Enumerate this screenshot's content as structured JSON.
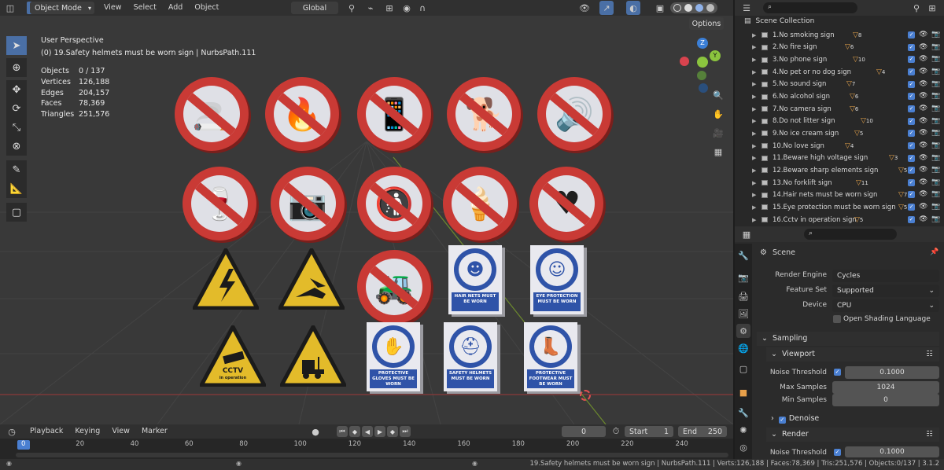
{
  "header": {
    "mode": "Object Mode",
    "menus": [
      "View",
      "Select",
      "Add",
      "Object"
    ],
    "transform_orientation": "Global",
    "options_label": "Options"
  },
  "viewport": {
    "perspective": "User Perspective",
    "active": "(0) 19.Safety helmets must be worn sign | NurbsPath.111",
    "stats": [
      {
        "label": "Objects",
        "value": "0 / 137"
      },
      {
        "label": "Vertices",
        "value": "126,188"
      },
      {
        "label": "Edges",
        "value": "204,157"
      },
      {
        "label": "Faces",
        "value": "78,369"
      },
      {
        "label": "Triangles",
        "value": "251,576"
      }
    ],
    "gizmo": {
      "z": "Z",
      "y": "Y",
      "x": "X"
    },
    "signs_text": {
      "cctv": "CCTV",
      "cctv_sub": "in operation",
      "hairnets": "HAIR NETS MUST BE WORN",
      "eye": "EYE PROTECTION MUST BE WORN",
      "gloves": "PROTECTIVE GLOVES MUST BE WORN",
      "helmets": "SAFETY HELMETS MUST BE WORN",
      "footwear": "PROTECTIVE FOOTWEAR MUST BE WORN"
    }
  },
  "outliner": {
    "root": "Scene Collection",
    "items": [
      {
        "name": "1.No smoking sign",
        "count": "8"
      },
      {
        "name": "2.No fire sign",
        "count": "6"
      },
      {
        "name": "3.No phone sign",
        "count": "10"
      },
      {
        "name": "4.No pet or no dog sign",
        "count": "4"
      },
      {
        "name": "5.No sound sign",
        "count": "7"
      },
      {
        "name": "6.No alcohol sign",
        "count": "6"
      },
      {
        "name": "7.No camera sign",
        "count": "6"
      },
      {
        "name": "8.Do not litter sign",
        "count": "10"
      },
      {
        "name": "9.No ice cream sign",
        "count": "5"
      },
      {
        "name": "10.No love sign",
        "count": "4"
      },
      {
        "name": "11.Beware high voltage sign",
        "count": "3"
      },
      {
        "name": "12.Beware sharp elements sign",
        "count": "5"
      },
      {
        "name": "13.No forklift sign",
        "count": "11"
      },
      {
        "name": "14.Hair nets must be worn sign",
        "count": "7"
      },
      {
        "name": "15.Eye protection must be worn sign",
        "count": "5"
      },
      {
        "name": "16.Cctv in operation sign",
        "count": "5"
      }
    ]
  },
  "properties": {
    "context": "Scene",
    "render_engine_label": "Render Engine",
    "render_engine": "Cycles",
    "feature_set_label": "Feature Set",
    "feature_set": "Supported",
    "device_label": "Device",
    "device": "CPU",
    "osl_label": "Open Shading Language",
    "sampling": "Sampling",
    "viewport": "Viewport",
    "noise_threshold_label": "Noise Threshold",
    "noise_threshold": "0.1000",
    "max_samples_label": "Max Samples",
    "max_samples": "1024",
    "min_samples_label": "Min Samples",
    "min_samples": "0",
    "denoise": "Denoise",
    "render": "Render",
    "render_noise_threshold_label": "Noise Threshold",
    "render_noise_threshold": "0.1000"
  },
  "timeline": {
    "menus": [
      "Playback",
      "Keying",
      "View",
      "Marker"
    ],
    "current_frame": "0",
    "start_label": "Start",
    "start": "1",
    "end_label": "End",
    "end": "250",
    "ticks": [
      "0",
      "20",
      "40",
      "60",
      "80",
      "100",
      "120",
      "140",
      "160",
      "180",
      "200",
      "220",
      "240"
    ]
  },
  "status_bar": "19.Safety helmets must be worn sign | NurbsPath.111 | Verts:126,188 | Faces:78,369 | Tris:251,576 | Objects:0/137 | 3.1.2"
}
